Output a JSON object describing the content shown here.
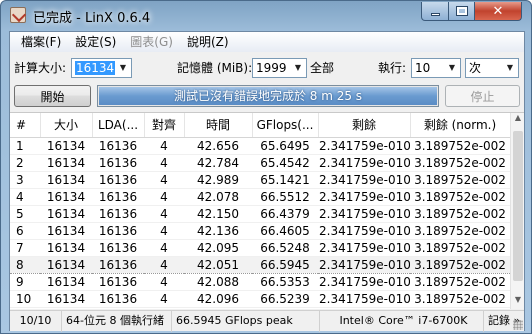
{
  "window": {
    "title": "已完成 - LinX 0.6.4",
    "close_label": "✕"
  },
  "menu": {
    "items": [
      "檔案(F)",
      "設定(S)",
      "圖表(G)",
      "說明(Z)"
    ]
  },
  "settings": {
    "problem_size_label": "計算大小:",
    "problem_size_value": "16134",
    "memory_label": "記憶體 (MiB):",
    "memory_value": "1999",
    "memory_all_label": "全部",
    "runs_label": "執行:",
    "runs_value": "10",
    "runs_unit_value": "次"
  },
  "controls": {
    "start_label": "開始",
    "stop_label": "停止",
    "progress_text": "測試已沒有錯誤地完成於 8 m 25 s",
    "progress_fraction": 1.0
  },
  "table": {
    "columns": [
      "#",
      "大小",
      "LDA(...",
      "對齊",
      "時間",
      "GFlops(...",
      "剩餘",
      "剩餘 (norm.)"
    ],
    "rows": [
      [
        "1",
        "16134",
        "16136",
        "4",
        "42.656",
        "65.6495",
        "2.341759e-010",
        "3.189752e-002"
      ],
      [
        "2",
        "16134",
        "16136",
        "4",
        "42.784",
        "65.4542",
        "2.341759e-010",
        "3.189752e-002"
      ],
      [
        "3",
        "16134",
        "16136",
        "4",
        "42.989",
        "65.1421",
        "2.341759e-010",
        "3.189752e-002"
      ],
      [
        "4",
        "16134",
        "16136",
        "4",
        "42.078",
        "66.5512",
        "2.341759e-010",
        "3.189752e-002"
      ],
      [
        "5",
        "16134",
        "16136",
        "4",
        "42.150",
        "66.4379",
        "2.341759e-010",
        "3.189752e-002"
      ],
      [
        "6",
        "16134",
        "16136",
        "4",
        "42.136",
        "66.4605",
        "2.341759e-010",
        "3.189752e-002"
      ],
      [
        "7",
        "16134",
        "16136",
        "4",
        "42.095",
        "66.5248",
        "2.341759e-010",
        "3.189752e-002"
      ],
      [
        "8",
        "16134",
        "16136",
        "4",
        "42.051",
        "66.5945",
        "2.341759e-010",
        "3.189752e-002"
      ],
      [
        "9",
        "16134",
        "16136",
        "4",
        "42.088",
        "66.5353",
        "2.341759e-010",
        "3.189752e-002"
      ],
      [
        "10",
        "16134",
        "16136",
        "4",
        "42.096",
        "66.5239",
        "2.341759e-010",
        "3.189752e-002"
      ]
    ],
    "selected_row": 8
  },
  "status": {
    "count": "10/10",
    "info": "64-位元 8 個執行緒",
    "peak": "66.5945 GFlops peak",
    "cpu": "Intel® Core™ i7-6700K",
    "log_label": "記錄 »"
  }
}
